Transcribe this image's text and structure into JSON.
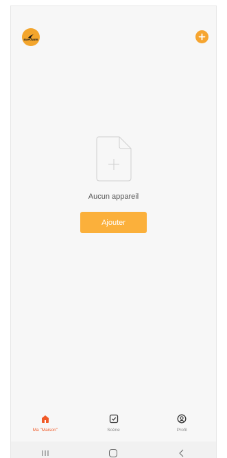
{
  "header": {
    "logo_text": "EMPOWER",
    "add_icon": "plus-circle-icon",
    "accent_color": "#f6a530"
  },
  "empty_state": {
    "icon": "empty-document-icon",
    "message": "Aucun appareil",
    "button_label": "Ajouter",
    "button_color": "#fbb03b"
  },
  "tabs": [
    {
      "label": "Ma \"Maison\"",
      "icon": "home-icon",
      "active": true,
      "color": "#f05a28"
    },
    {
      "label": "Scène",
      "icon": "scene-checkbox-icon",
      "active": false
    },
    {
      "label": "Profil",
      "icon": "profile-icon",
      "active": false
    }
  ],
  "system_nav": {
    "recent": "recent-apps-icon",
    "home": "home-button-icon",
    "back": "back-icon"
  }
}
